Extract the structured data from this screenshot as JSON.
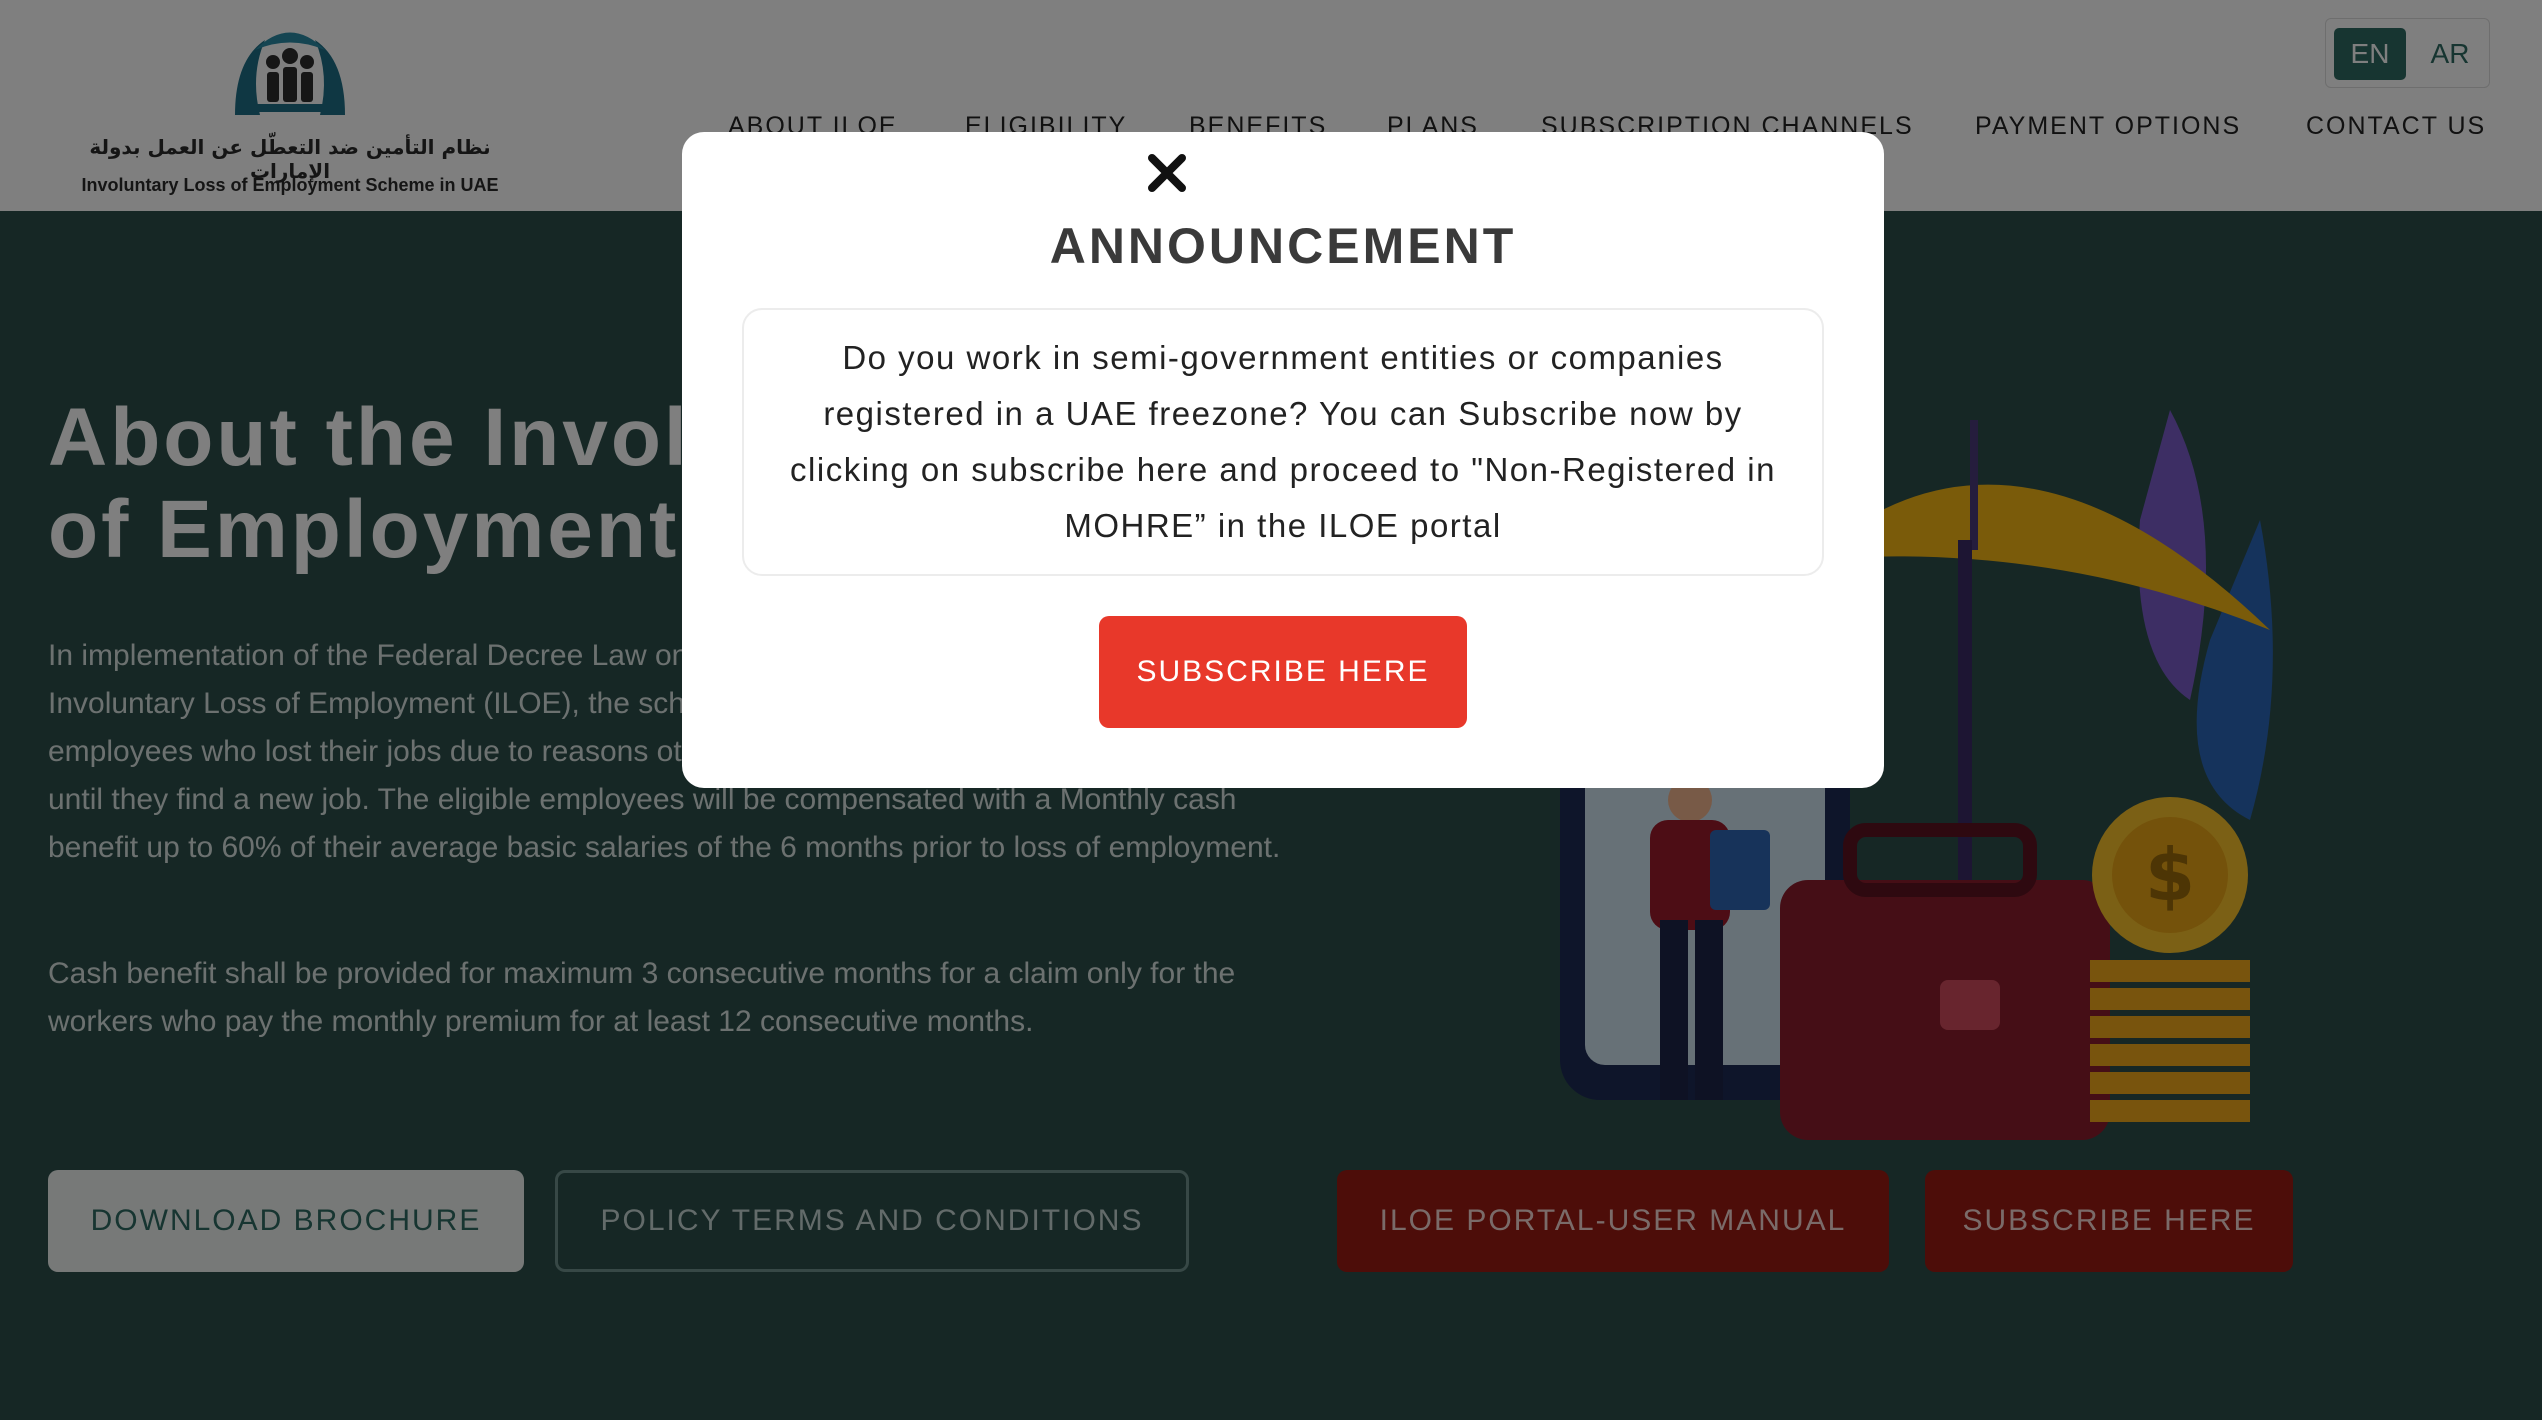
{
  "header": {
    "logo_arabic": "نظام التأمين ضد التعطّل عن العمل بدولة الإمارات",
    "logo_english": "Involuntary Loss of Employment Scheme in UAE",
    "nav": [
      {
        "label": "ABOUT ILOE"
      },
      {
        "label": "ELIGIBILITY"
      },
      {
        "label": "BENEFITS"
      },
      {
        "label": "PLANS"
      },
      {
        "label": "SUBSCRIPTION CHANNELS"
      },
      {
        "label": "PAYMENT OPTIONS"
      },
      {
        "label": "CONTACT US"
      }
    ],
    "lang": {
      "en": "EN",
      "ar": "AR",
      "active": "EN"
    }
  },
  "hero": {
    "title_line1": "About the Involuntary Loss",
    "title_line2": "of Employment (ILOE)",
    "para1": "In implementation of the Federal Decree Law on the Unemployment Insurance Scheme, Involuntary Loss of Employment (ILOE), the scheme aims to provide financial support for employees who lost their jobs due to reasons other than disciplinary reasons or resignation until they find a new job. The eligible employees will be compensated with a Monthly cash benefit up to 60% of their average basic salaries of the 6 months prior to loss of employment.",
    "para2": "Cash benefit shall be provided for maximum 3 consecutive months for a claim only for the workers who pay the monthly premium for at least 12 consecutive months.",
    "buttons": {
      "download": "DOWNLOAD BROCHURE",
      "policy": "POLICY TERMS AND CONDITIONS",
      "manual": "ILOE PORTAL-USER MANUAL",
      "subscribe": "SUBSCRIBE HERE"
    }
  },
  "modal": {
    "title": "ANNOUNCEMENT",
    "message": "Do you work in semi-government entities or companies registered in a UAE freezone? You can Subscribe now by clicking on subscribe here and proceed to \"Non-Registered in MOHRE” in the ILOE portal",
    "button": "SUBSCRIBE HERE",
    "close_icon": "close-icon"
  },
  "colors": {
    "brand_green": "#2f6b62",
    "accent_red": "#e8382a",
    "dark_red": "#9b1a12"
  }
}
